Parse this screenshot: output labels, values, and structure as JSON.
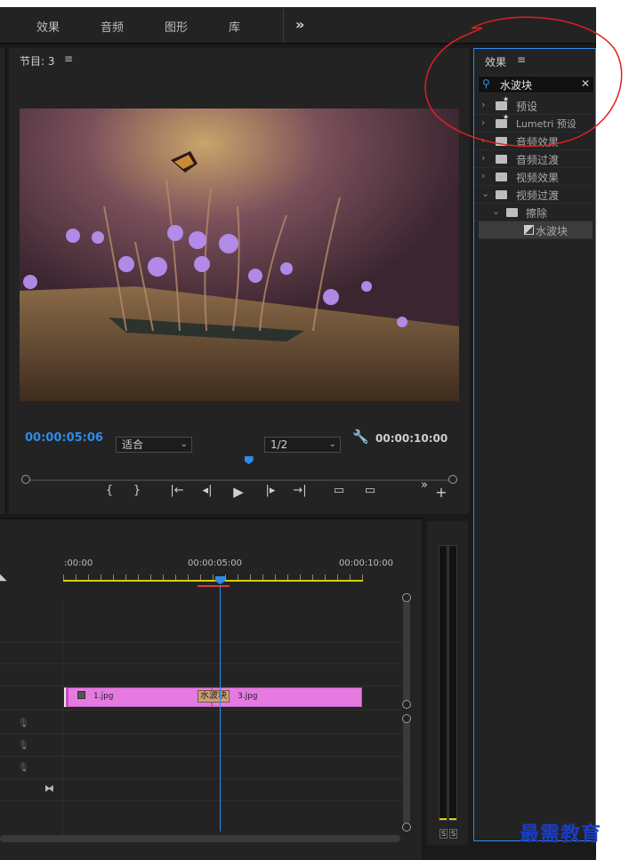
{
  "workspace_tabs": [
    "效果",
    "音频",
    "图形",
    "库"
  ],
  "workspace_more": "»",
  "program_monitor": {
    "title": "节目: 3",
    "menu": "≡",
    "current_timecode": "00:00:05:06",
    "fit_select": "适合",
    "resolution_select": "1/2",
    "duration_timecode": "00:00:10:00",
    "playhead_fraction": 0.52,
    "controls": [
      "{",
      "}",
      "|←",
      "◂|",
      "▶",
      "|▸",
      "→|",
      "lift",
      "extract"
    ],
    "add_button": "+",
    "more_button": "»"
  },
  "timeline": {
    "ruler_labels": [
      ":00:00",
      "00:00:05:00",
      "00:00:10:00"
    ],
    "clips": [
      {
        "name": "1.jpg"
      },
      {
        "name": "3.jpg"
      }
    ],
    "transition": "水波块"
  },
  "meter": {
    "solo_labels": [
      "S",
      "S"
    ]
  },
  "effects_panel": {
    "title": "效果",
    "menu": "≡",
    "search_value": "水波块",
    "clear": "✕",
    "tree": [
      {
        "arrow": "›",
        "label": "预设",
        "star": true
      },
      {
        "arrow": "›",
        "label": "Lumetri 预设",
        "star": true
      },
      {
        "arrow": "›",
        "label": "音频效果",
        "star": false
      },
      {
        "arrow": "›",
        "label": "音频过渡",
        "star": false
      },
      {
        "arrow": "›",
        "label": "视频效果",
        "star": false
      },
      {
        "arrow": "⌄",
        "label": "视频过渡",
        "star": false
      },
      {
        "arrow": "⌄",
        "label": "擦除",
        "star": false
      },
      {
        "arrow": "",
        "label": "水波块",
        "star": false
      }
    ]
  },
  "watermark": "最需教育"
}
